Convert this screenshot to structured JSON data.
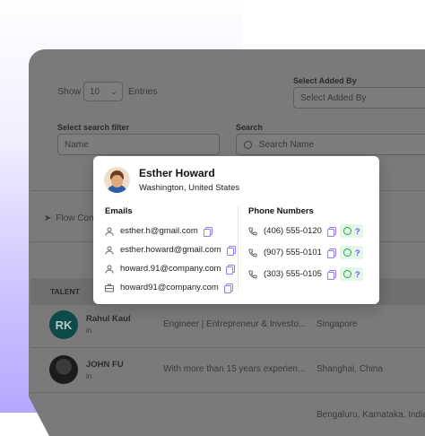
{
  "list": {
    "show_label": "Show",
    "page_size": "10",
    "entries_label": "Entries",
    "added_by_label": "Select Added By",
    "added_by_placeholder": "Select Added By",
    "filter_label": "Select search filter",
    "filter_value": "Name",
    "search_label": "Search",
    "search_placeholder": "Search Name",
    "flow_label": "Flow Con",
    "table_header": "TALENT",
    "rows": [
      {
        "initials": "RK",
        "name": "Rahul Kaul",
        "desc": "Engineer | Entrepreneur & Investo...",
        "location": "Singapore"
      },
      {
        "initials": "",
        "name": "JOHN FU",
        "desc": "With more than 15 years experien...",
        "location": "Shanghai, China"
      },
      {
        "initials": "",
        "name": "",
        "desc": "",
        "location": "Bengaluru, Karnataka, India"
      }
    ]
  },
  "card": {
    "name": "Esther Howard",
    "location": "Washington, United States",
    "emails_label": "Emails",
    "phones_label": "Phone Numbers",
    "emails": [
      {
        "icon": "user-icon",
        "value": "esther.h@gmail.com"
      },
      {
        "icon": "user-icon",
        "value": "esther.howard@gmail.com"
      },
      {
        "icon": "user-icon",
        "value": "howard.91@company.com"
      },
      {
        "icon": "briefcase-icon",
        "value": "howard91@company.com"
      }
    ],
    "phones": [
      {
        "value": "(406) 555-0120",
        "badge": "?"
      },
      {
        "value": "(907) 555-0101",
        "badge": "?"
      },
      {
        "value": "(303) 555-0105",
        "badge": "?"
      }
    ]
  },
  "colors": {
    "accent": "#6b56ff",
    "overlay": "#7a7a7a",
    "whatsapp": "#25a748"
  }
}
